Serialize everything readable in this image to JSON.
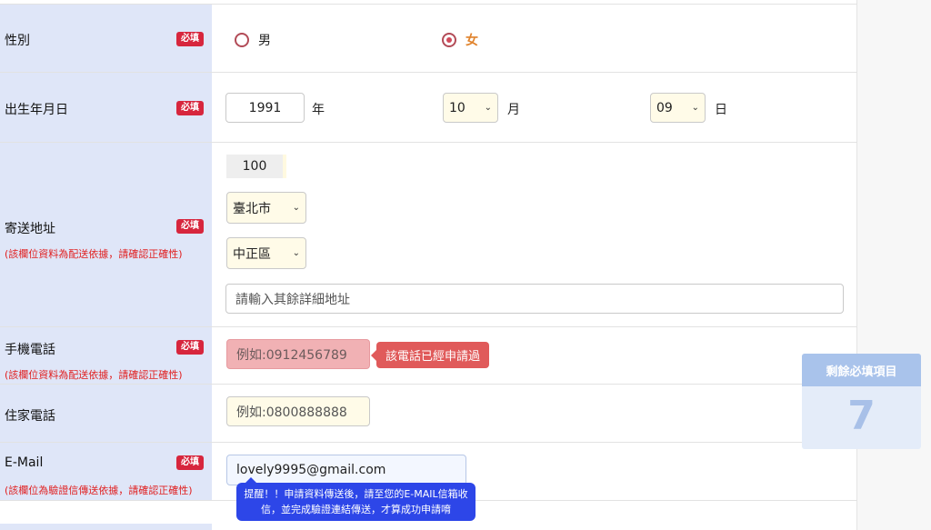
{
  "gender": {
    "label": "性別",
    "required": "必填",
    "options": [
      {
        "label": "男",
        "selected": false
      },
      {
        "label": "女",
        "selected": true
      }
    ]
  },
  "birthday": {
    "label": "出生年月日",
    "required": "必填",
    "year": "1991",
    "year_unit": "年",
    "month": "10",
    "month_unit": "月",
    "day": "09",
    "day_unit": "日"
  },
  "address": {
    "label": "寄送地址",
    "required": "必填",
    "note": "(該欄位資料為配送依據，請確認正確性)",
    "zip": "100",
    "city": "臺北市",
    "district": "中正區",
    "detail_placeholder": "請輸入其餘詳細地址"
  },
  "mobile": {
    "label": "手機電話",
    "required": "必填",
    "note": "(該欄位資料為配送依據，請確認正確性)",
    "placeholder": "例如:0912456789",
    "error": "該電話已經申請過"
  },
  "home_phone": {
    "label": "住家電話",
    "placeholder": "例如:0800888888"
  },
  "email": {
    "label": "E-Mail",
    "required": "必填",
    "note": "(該欄位為驗證信傳送依據，請確認正確性)",
    "value": "lovely9995@gmail.com",
    "tip": "提醒！！申請資料傳送後，請至您的E-MAIL信箱收信，並完成驗證連結傳送，才算成功申請唷"
  },
  "remaining": {
    "title": "剩餘必填項目",
    "count": "7"
  },
  "colors": {
    "label_bg": "#dfe6f8",
    "required_badge": "#d7263d",
    "error_tip": "#e05a5a",
    "info_tip": "#2d46e8",
    "selected_text": "#e0832c"
  }
}
